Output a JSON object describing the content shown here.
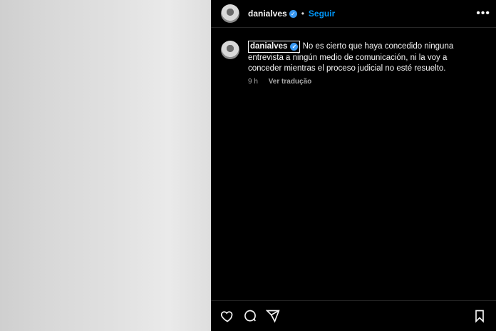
{
  "post": {
    "username": "danialves",
    "follow_label": "Seguir",
    "separator": "•",
    "more_label": "•••"
  },
  "comment": {
    "username": "danialves",
    "text": "No es cierto que haya concedido ninguna entrevista a ningún medio de comunicación, ni la voy a conceder mientras el proceso judicial no esté resuelto.",
    "time": "9 h",
    "translate_label": "Ver tradução"
  },
  "icons": {
    "verified": "verified-badge-icon",
    "like": "heart-icon",
    "comment": "comment-icon",
    "share": "send-icon",
    "save": "bookmark-icon"
  },
  "colors": {
    "accent": "#0095f6",
    "verified": "#3897f0",
    "background": "#000000",
    "muted_text": "#a8a8a8"
  }
}
